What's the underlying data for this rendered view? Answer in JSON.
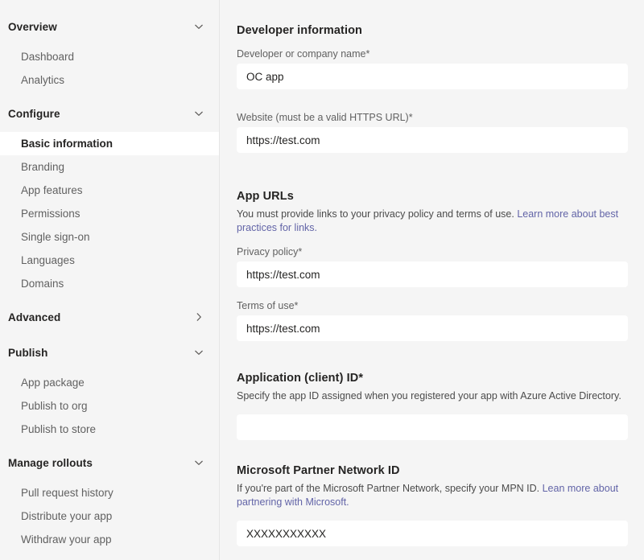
{
  "sidebar": {
    "groups": [
      {
        "label": "Overview",
        "icon": "chevron-down-icon",
        "expanded": true,
        "items": [
          {
            "label": "Dashboard",
            "selected": false
          },
          {
            "label": "Analytics",
            "selected": false
          }
        ]
      },
      {
        "label": "Configure",
        "icon": "chevron-down-icon",
        "expanded": true,
        "items": [
          {
            "label": "Basic information",
            "selected": true
          },
          {
            "label": "Branding",
            "selected": false
          },
          {
            "label": "App features",
            "selected": false
          },
          {
            "label": "Permissions",
            "selected": false
          },
          {
            "label": "Single sign-on",
            "selected": false
          },
          {
            "label": "Languages",
            "selected": false
          },
          {
            "label": "Domains",
            "selected": false
          }
        ]
      },
      {
        "label": "Advanced",
        "icon": "chevron-right-icon",
        "expanded": false,
        "items": []
      },
      {
        "label": "Publish",
        "icon": "chevron-down-icon",
        "expanded": true,
        "items": [
          {
            "label": "App package",
            "selected": false
          },
          {
            "label": "Publish to org",
            "selected": false
          },
          {
            "label": "Publish to store",
            "selected": false
          }
        ]
      },
      {
        "label": "Manage rollouts",
        "icon": "chevron-down-icon",
        "expanded": true,
        "items": [
          {
            "label": "Pull request history",
            "selected": false
          },
          {
            "label": "Distribute your app",
            "selected": false
          },
          {
            "label": "Withdraw your app",
            "selected": false
          }
        ]
      }
    ]
  },
  "main": {
    "developer_information": {
      "title": "Developer information",
      "company_name": {
        "label": "Developer or company name*",
        "value": "OC app",
        "placeholder": ""
      },
      "website": {
        "label": "Website (must be a valid HTTPS URL)*",
        "value": "https://test.com",
        "placeholder": ""
      }
    },
    "app_urls": {
      "title": "App URLs",
      "description_prefix": "You must provide links to your privacy policy and terms of use. ",
      "description_link": "Learn more about best practices for links.",
      "privacy_policy": {
        "label": "Privacy policy*",
        "value": "https://test.com",
        "placeholder": ""
      },
      "terms_of_use": {
        "label": "Terms of use*",
        "value": "https://test.com",
        "placeholder": ""
      }
    },
    "application_client_id": {
      "title": "Application (client) ID*",
      "description": "Specify the app ID assigned when you registered your app with Azure Active Directory.",
      "value": "",
      "placeholder": ""
    },
    "microsoft_partner_network_id": {
      "title": "Microsoft Partner Network ID",
      "description_prefix": "If you're part of the Microsoft Partner Network, specify your MPN ID. ",
      "description_link": "Lean more about partnering with Microsoft.",
      "value": "XXXXXXXXXXX",
      "placeholder": ""
    }
  },
  "colors": {
    "page_background": "#f5f5f5",
    "input_background": "#ffffff",
    "link": "#6264a7",
    "text_primary": "#252423",
    "text_secondary": "#616161",
    "selected_item_background": "#ffffff"
  }
}
